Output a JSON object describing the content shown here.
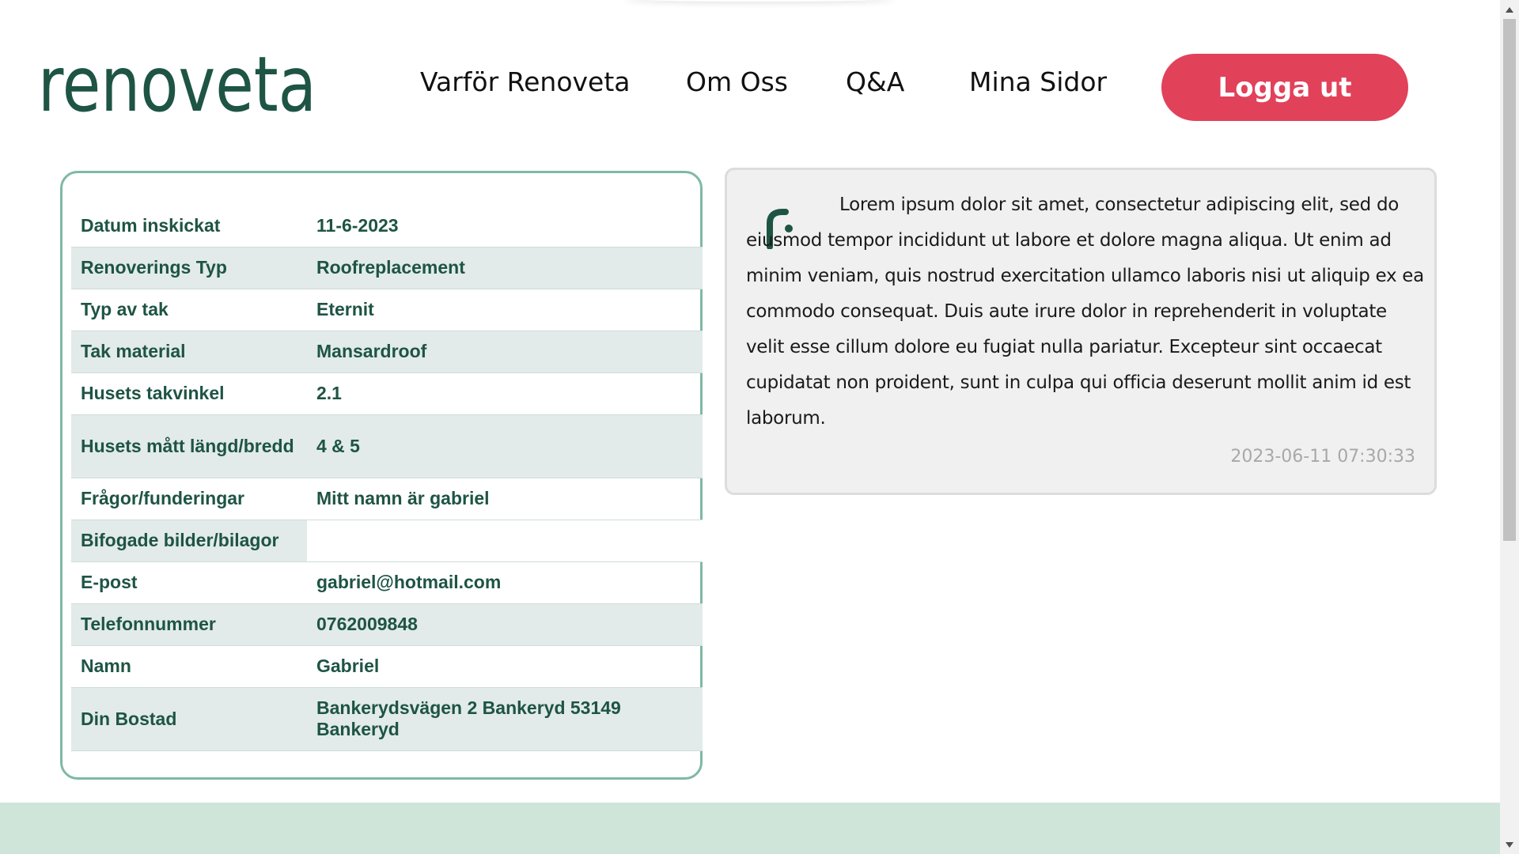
{
  "header": {
    "logo_text": "renoveta",
    "nav": [
      "Varför Renoveta",
      "Om Oss",
      "Q&A",
      "Mina Sidor"
    ],
    "logout_label": "Logga ut"
  },
  "details": {
    "rows": [
      {
        "label": "Datum inskickat",
        "value": "11-6-2023"
      },
      {
        "label": "Renoverings Typ",
        "value": "Roofreplacement"
      },
      {
        "label": "Typ av tak",
        "value": "Eternit"
      },
      {
        "label": "Tak material",
        "value": "Mansardroof"
      },
      {
        "label": "Husets takvinkel",
        "value": "2.1"
      },
      {
        "label": "Husets mått längd/bredd",
        "value": "4 & 5"
      },
      {
        "label": "Frågor/funderingar",
        "value": "Mitt namn är gabriel"
      },
      {
        "label": "Bifogade bilder/bilagor",
        "value": ""
      },
      {
        "label": "E-post",
        "value": "gabriel@hotmail.com"
      },
      {
        "label": "Telefonnummer",
        "value": "0762009848"
      },
      {
        "label": "Namn",
        "value": "Gabriel"
      },
      {
        "label": "Din Bostad",
        "value": "Bankerydsvägen 2 Bankeryd 53149 Bankeryd"
      }
    ]
  },
  "message": {
    "icon": "renoveta-r-icon",
    "text": "Lorem ipsum dolor sit amet, consectetur adipiscing elit, sed do eiusmod tempor incididunt ut labore et dolore magna aliqua. Ut enim ad minim veniam, quis nostrud exercitation ullamco laboris nisi ut aliquip ex ea commodo consequat. Duis aute irure dolor in reprehenderit in voluptate velit esse cillum dolore eu fugiat nulla pariatur. Excepteur sint occaecat cupidatat non proident, sunt in culpa qui officia deserunt mollit anim id est laborum.",
    "timestamp": "2023-06-11 07:30:33"
  },
  "colors": {
    "brand_green": "#1e5444",
    "logout_red": "#e2415a",
    "card_border": "#7fb8a6",
    "row_shade": "#e2ebe9",
    "footer": "#cfe5da"
  }
}
